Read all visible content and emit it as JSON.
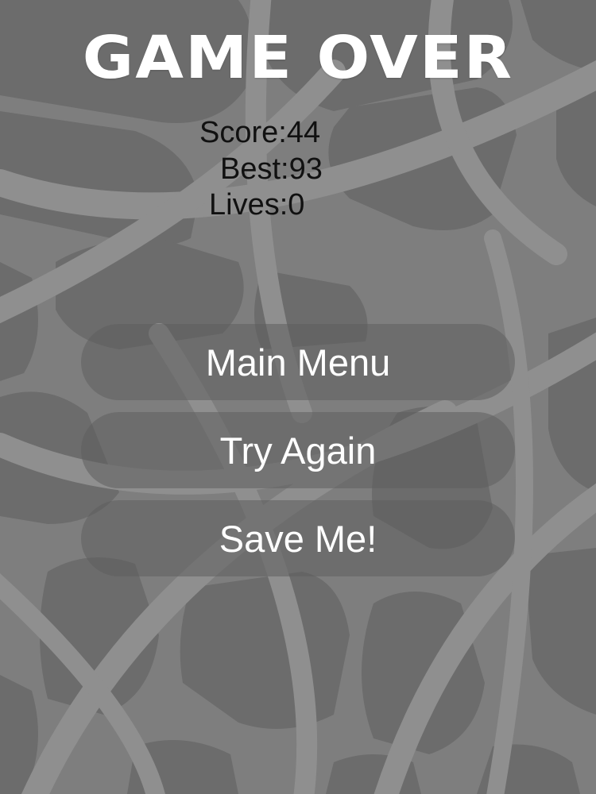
{
  "title": "GAME OVER",
  "stats": {
    "score_label": "Score:44",
    "best_label": "Best:93",
    "lives_label": "Lives:0"
  },
  "buttons": {
    "main_menu": "Main Menu",
    "try_again": "Try Again",
    "save_me": "Save Me!"
  },
  "colors": {
    "background": "#7d7d7d",
    "title": "#ffffff",
    "stats_text": "#111111",
    "button_fill": "#5f5f5f",
    "button_text": "#ffffff"
  }
}
